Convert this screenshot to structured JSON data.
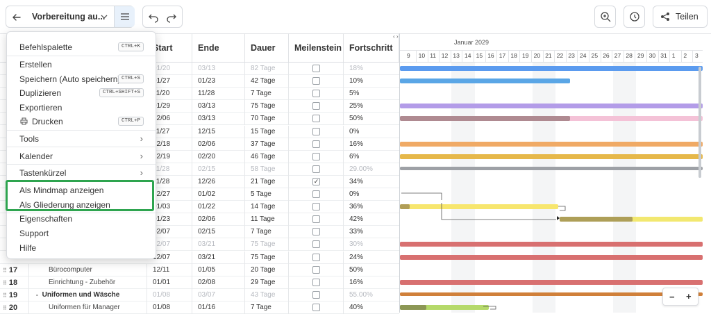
{
  "toolbar": {
    "back_icon": "arrow-left-icon",
    "project_title": "Vorbereitung au...",
    "dropdown_icon": "chevron-down-icon",
    "menu_icon": "hamburger-icon",
    "undo_icon": "undo-icon",
    "redo_icon": "redo-icon",
    "zoom_icon": "zoom-fit-icon",
    "history_icon": "clock-icon",
    "share_icon": "share-icon",
    "share_label": "Teilen"
  },
  "menu": {
    "items": [
      {
        "label": "Befehlspalette",
        "shortcut": "CTRL+K"
      },
      {
        "label": "Erstellen",
        "shortcut": ""
      },
      {
        "label": "Speichern (Auto speichern)",
        "shortcut": "CTRL+S"
      },
      {
        "label": "Duplizieren",
        "shortcut": "CTRL+SHIFT+S"
      },
      {
        "label": "Exportieren",
        "shortcut": ""
      },
      {
        "label": "Drucken",
        "shortcut": "CTRL+P"
      },
      {
        "label": "Tools",
        "shortcut": ""
      },
      {
        "label": "Kalender",
        "shortcut": ""
      },
      {
        "label": "Tastenkürzel",
        "shortcut": ""
      },
      {
        "label": "Als Mindmap anzeigen",
        "shortcut": ""
      },
      {
        "label": "Als Gliederung anzeigen",
        "shortcut": ""
      },
      {
        "label": "Eigenschaften",
        "shortcut": ""
      },
      {
        "label": "Support",
        "shortcut": ""
      },
      {
        "label": "Hilfe",
        "shortcut": ""
      }
    ],
    "highlight_color": "#2ea44f"
  },
  "table": {
    "columns": [
      "Start",
      "Ende",
      "Dauer",
      "Meilenstein",
      "Fortschritt"
    ],
    "rows": [
      {
        "start": "01/20",
        "end": "03/13",
        "duration": "82 Tage",
        "milestone": false,
        "progress": "18%",
        "dim": true
      },
      {
        "start": "01/27",
        "end": "01/23",
        "duration": "42 Tage",
        "milestone": false,
        "progress": "10%",
        "dim": false
      },
      {
        "start": "11/20",
        "end": "11/28",
        "duration": "7 Tage",
        "milestone": false,
        "progress": "5%",
        "dim": false
      },
      {
        "start": "01/29",
        "end": "03/13",
        "duration": "75 Tage",
        "milestone": false,
        "progress": "25%",
        "dim": false
      },
      {
        "start": "12/06",
        "end": "03/13",
        "duration": "70 Tage",
        "milestone": false,
        "progress": "50%",
        "dim": false
      },
      {
        "start": "11/27",
        "end": "12/15",
        "duration": "15 Tage",
        "milestone": false,
        "progress": "0%",
        "dim": false
      },
      {
        "start": "12/18",
        "end": "02/06",
        "duration": "37 Tage",
        "milestone": false,
        "progress": "16%",
        "dim": false
      },
      {
        "start": "12/19",
        "end": "02/20",
        "duration": "46 Tage",
        "milestone": false,
        "progress": "6%",
        "dim": false
      },
      {
        "start": "11/28",
        "end": "02/15",
        "duration": "58 Tage",
        "milestone": false,
        "progress": "29.00%",
        "dim": true
      },
      {
        "start": "11/28",
        "end": "12/26",
        "duration": "21 Tage",
        "milestone": true,
        "progress": "34%",
        "dim": false
      },
      {
        "start": "12/27",
        "end": "01/02",
        "duration": "5 Tage",
        "milestone": false,
        "progress": "0%",
        "dim": false
      },
      {
        "start": "01/03",
        "end": "01/22",
        "duration": "14 Tage",
        "milestone": false,
        "progress": "36%",
        "dim": false
      },
      {
        "start": "01/23",
        "end": "02/06",
        "duration": "11 Tage",
        "milestone": false,
        "progress": "42%",
        "dim": false
      },
      {
        "start": "02/07",
        "end": "02/15",
        "duration": "7 Tage",
        "milestone": false,
        "progress": "33%",
        "dim": false
      },
      {
        "start": "12/07",
        "end": "03/21",
        "duration": "75 Tage",
        "milestone": false,
        "progress": "30%",
        "dim": true
      },
      {
        "start": "12/07",
        "end": "03/21",
        "duration": "75 Tage",
        "milestone": false,
        "progress": "24%",
        "dim": false
      },
      {
        "id": "17",
        "name": "Bürocomputer",
        "start": "12/11",
        "end": "01/05",
        "duration": "20 Tage",
        "milestone": false,
        "progress": "50%",
        "dim": false
      },
      {
        "id": "18",
        "name": "Einrichtung - Zubehör",
        "start": "01/01",
        "end": "02/08",
        "duration": "29 Tage",
        "milestone": false,
        "progress": "16%",
        "dim": false
      },
      {
        "id": "19",
        "name": "Uniformen und Wäsche",
        "start": "01/08",
        "end": "03/07",
        "duration": "43 Tage",
        "milestone": false,
        "progress": "55.00%",
        "dim": true,
        "group": true
      },
      {
        "id": "20",
        "name": "Uniformen für Manager",
        "start": "01/08",
        "end": "01/16",
        "duration": "7 Tage",
        "milestone": false,
        "progress": "40%",
        "dim": false
      }
    ]
  },
  "gantt": {
    "month": "Januar 2029",
    "days": [
      "9",
      "10",
      "11",
      "12",
      "13",
      "14",
      "15",
      "16",
      "17",
      "18",
      "19",
      "20",
      "21",
      "22",
      "23",
      "24",
      "25",
      "26",
      "27",
      "28",
      "29",
      "30",
      "31",
      "1",
      "2",
      "3"
    ],
    "bar_colors": [
      "#5b9bef",
      "#5aa6e6",
      "",
      "#b39ce8",
      "#f2b8d0",
      "",
      "#f0aa65",
      "#e6b84a",
      "#9ea1a6",
      "",
      "",
      "#f7e66e",
      "#f2e870",
      "",
      "#d87070",
      "#d87070",
      "",
      "#d87070",
      "#d0803a",
      "#b5d96a"
    ],
    "zoom_out": "−",
    "zoom_in": "+"
  }
}
